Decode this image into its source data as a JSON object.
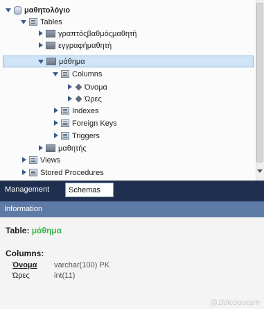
{
  "tree": {
    "schema": {
      "label": "μαθητολόγιο"
    },
    "tables_folder": {
      "label": "Tables"
    },
    "tables": [
      {
        "label": "γραπτόςβαθμόςμαθητή"
      },
      {
        "label": "εγγραφήμαθητή"
      },
      {
        "label": "μάθημα"
      },
      {
        "label": "μαθητής"
      }
    ],
    "columns_folder": {
      "label": "Columns"
    },
    "columns": [
      {
        "label": "Όνομα"
      },
      {
        "label": "Ώρες"
      }
    ],
    "indexes": {
      "label": "Indexes"
    },
    "foreign_keys": {
      "label": "Foreign Keys"
    },
    "triggers": {
      "label": "Triggers"
    },
    "views": {
      "label": "Views"
    },
    "stored_procedures": {
      "label": "Stored Procedures"
    }
  },
  "tabs": [
    {
      "label": "Management"
    },
    {
      "label": "Schemas"
    }
  ],
  "info": {
    "header": "Information",
    "table_label": "Table:",
    "table_name": "μάθημα",
    "columns_label": "Columns:",
    "columns": [
      {
        "name": "Όνομα",
        "type": "varchar(100) PK"
      },
      {
        "name": "Ώρες",
        "type": "int(11)"
      }
    ]
  },
  "watermark": "@1ldlcooocsm",
  "colors": {
    "tab_bar": "#1f2f4f",
    "info_header": "#5e7aa6",
    "table_name": "#39b54a",
    "selection": "#cfe4f7"
  }
}
